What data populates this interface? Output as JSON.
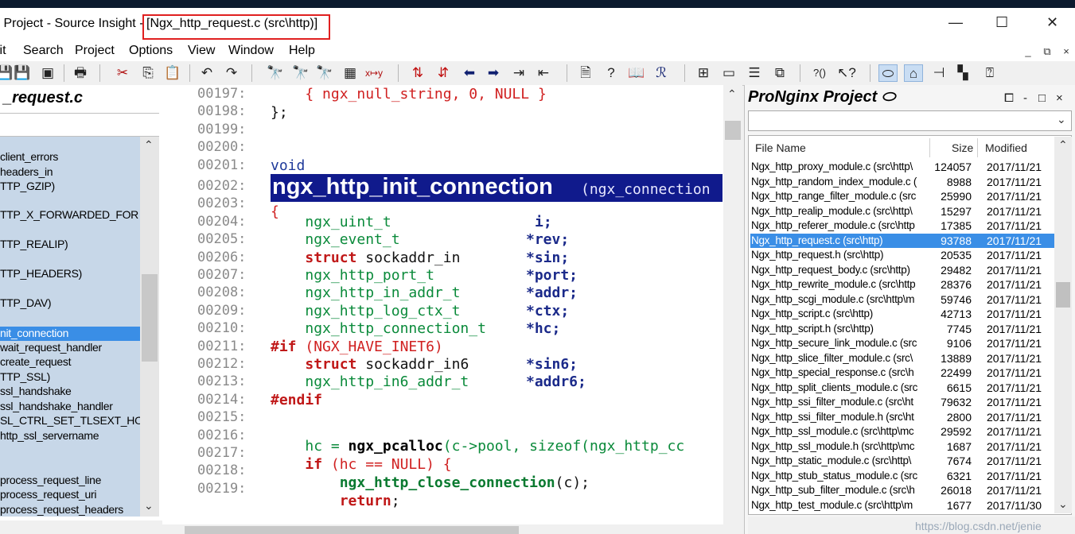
{
  "window": {
    "title_prefix": "x Project - Source Insight - ",
    "title_file": "[Ngx_http_request.c (src\\http)]",
    "minimize": "—",
    "maximize": "☐",
    "close": "✕"
  },
  "menu": {
    "items": [
      "lit",
      "Search",
      "Project",
      "Options",
      "View",
      "Window",
      "Help"
    ],
    "mdi": [
      "_",
      "⧉",
      "×"
    ]
  },
  "toolbar": {
    "icons": [
      "save-icon",
      "save-all-icon",
      "save-copy-icon",
      "print-icon",
      "cut-icon",
      "copy-icon",
      "paste-icon",
      "undo-icon",
      "redo-icon",
      "find-icon",
      "find-prev-icon",
      "find-next-icon",
      "search-files-icon",
      "replace-icon",
      "bookmark-prev-icon",
      "bookmark-next-icon",
      "back-icon",
      "forward-icon",
      "go-line-icon",
      "jump-icon",
      "symbol-info-icon",
      "lookup-icon",
      "book-icon",
      "relation-icon",
      "layout1-icon",
      "layout2-icon",
      "layout3-icon",
      "layout4-icon",
      "context-icon",
      "help-pointer-icon",
      "project-icon",
      "browse-icon",
      "relation-window-icon",
      "split-icon",
      "help-icon"
    ]
  },
  "symbol_window": {
    "title": "_request.c",
    "items": [
      "client_errors",
      "headers_in",
      "TTP_GZIP)",
      "TTP_X_FORWARDED_FOR",
      "TTP_REALIP)",
      "TTP_HEADERS)",
      "TTP_DAV)",
      "nit_connection",
      "wait_request_handler",
      "create_request",
      "TTP_SSL)",
      "ssl_handshake",
      "ssl_handshake_handler",
      "SL_CTRL_SET_TLSEXT_HO",
      "http_ssl_servername",
      "process_request_line",
      "process_request_uri",
      "process_request_headers"
    ],
    "selected_index": 7
  },
  "code": {
    "lines": [
      {
        "num": "00197:",
        "text": "    { ngx_null_string, 0, NULL }"
      },
      {
        "num": "00198:",
        "text": "};"
      },
      {
        "num": "00199:",
        "text": ""
      },
      {
        "num": "00200:",
        "text": ""
      },
      {
        "num": "00201:",
        "text": "void"
      },
      {
        "num": "00202:",
        "text": ""
      },
      {
        "num": "00203:",
        "text": "{"
      },
      {
        "num": "00204:",
        "text": "ngx_uint_t",
        "var": "i;"
      },
      {
        "num": "00205:",
        "text": "ngx_event_t",
        "var": "*rev;"
      },
      {
        "num": "00206:",
        "text": "sockaddr_in",
        "kw": "struct",
        "var": "*sin;"
      },
      {
        "num": "00207:",
        "text": "ngx_http_port_t",
        "var": "*port;"
      },
      {
        "num": "00208:",
        "text": "ngx_http_in_addr_t",
        "var": "*addr;"
      },
      {
        "num": "00209:",
        "text": "ngx_http_log_ctx_t",
        "var": "*ctx;"
      },
      {
        "num": "00210:",
        "text": "ngx_http_connection_t",
        "var": "*hc;"
      },
      {
        "num": "00211:",
        "text": "(NGX_HAVE_INET6)",
        "kw": "#if"
      },
      {
        "num": "00212:",
        "text": "sockaddr_in6",
        "kw": "struct",
        "var": "*sin6;"
      },
      {
        "num": "00213:",
        "text": "ngx_http_in6_addr_t",
        "var": "*addr6;"
      },
      {
        "num": "00214:",
        "text": "",
        "kw": "#endif"
      },
      {
        "num": "00215:",
        "text": ""
      },
      {
        "num": "00216:",
        "text": "hc = ngx_pcalloc(c->pool, sizeof(ngx_http_cc"
      },
      {
        "num": "00217:",
        "text": "if (hc == NULL) {"
      },
      {
        "num": "00218:",
        "text": "ngx_http_close_connection(c);"
      },
      {
        "num": "00219:",
        "text": "return;"
      }
    ],
    "banner_name": "ngx_http_init_connection",
    "banner_args": "(ngx_connection",
    "l216_pre": "hc = ",
    "l216_fn": "ngx_pcalloc",
    "l216_post": "(c->pool, sizeof(ngx_http_cc",
    "l217_kw": "if",
    "l217_rest": " (hc == NULL) {",
    "l218_fn": "ngx_http_close_connection",
    "l218_rest": "(c);",
    "l219_kw": "return",
    "l219_rest": ";"
  },
  "project_window": {
    "title": "ProNginx Project",
    "controls": [
      "⧠",
      "-",
      "□",
      "×"
    ],
    "columns": [
      "File Name",
      "Size",
      "Modified"
    ],
    "rows": [
      {
        "name": "Ngx_http_proxy_module.c (src\\http\\",
        "size": "124057",
        "date": "2017/11/21"
      },
      {
        "name": "Ngx_http_random_index_module.c (",
        "size": "8988",
        "date": "2017/11/21"
      },
      {
        "name": "Ngx_http_range_filter_module.c (src",
        "size": "25990",
        "date": "2017/11/21"
      },
      {
        "name": "Ngx_http_realip_module.c (src\\http\\",
        "size": "15297",
        "date": "2017/11/21"
      },
      {
        "name": "Ngx_http_referer_module.c (src\\http",
        "size": "17385",
        "date": "2017/11/21"
      },
      {
        "name": "Ngx_http_request.c (src\\http)",
        "size": "93788",
        "date": "2017/11/21"
      },
      {
        "name": "Ngx_http_request.h (src\\http)",
        "size": "20535",
        "date": "2017/11/21"
      },
      {
        "name": "Ngx_http_request_body.c (src\\http)",
        "size": "29482",
        "date": "2017/11/21"
      },
      {
        "name": "Ngx_http_rewrite_module.c (src\\http",
        "size": "28376",
        "date": "2017/11/21"
      },
      {
        "name": "Ngx_http_scgi_module.c (src\\http\\m",
        "size": "59746",
        "date": "2017/11/21"
      },
      {
        "name": "Ngx_http_script.c (src\\http)",
        "size": "42713",
        "date": "2017/11/21"
      },
      {
        "name": "Ngx_http_script.h (src\\http)",
        "size": "7745",
        "date": "2017/11/21"
      },
      {
        "name": "Ngx_http_secure_link_module.c (src",
        "size": "9106",
        "date": "2017/11/21"
      },
      {
        "name": "Ngx_http_slice_filter_module.c (src\\",
        "size": "13889",
        "date": "2017/11/21"
      },
      {
        "name": "Ngx_http_special_response.c (src\\h",
        "size": "22499",
        "date": "2017/11/21"
      },
      {
        "name": "Ngx_http_split_clients_module.c (src",
        "size": "6615",
        "date": "2017/11/21"
      },
      {
        "name": "Ngx_http_ssi_filter_module.c (src\\ht",
        "size": "79632",
        "date": "2017/11/21"
      },
      {
        "name": "Ngx_http_ssi_filter_module.h (src\\ht",
        "size": "2800",
        "date": "2017/11/21"
      },
      {
        "name": "Ngx_http_ssl_module.c (src\\http\\mc",
        "size": "29592",
        "date": "2017/11/21"
      },
      {
        "name": "Ngx_http_ssl_module.h (src\\http\\mc",
        "size": "1687",
        "date": "2017/11/21"
      },
      {
        "name": "Ngx_http_static_module.c (src\\http\\",
        "size": "7674",
        "date": "2017/11/21"
      },
      {
        "name": "Ngx_http_stub_status_module.c (src",
        "size": "6321",
        "date": "2017/11/21"
      },
      {
        "name": "Ngx_http_sub_filter_module.c (src\\h",
        "size": "26018",
        "date": "2017/11/21"
      },
      {
        "name": "Ngx_http_test_module.c (src\\http\\m",
        "size": "1677",
        "date": "2017/11/30"
      }
    ],
    "selected_index": 5
  },
  "watermark": "https://blog.csdn.net/jenie",
  "colors": {
    "banner": "#101a8c",
    "selection": "#3a8ee6",
    "highlight_box": "#e02020"
  }
}
